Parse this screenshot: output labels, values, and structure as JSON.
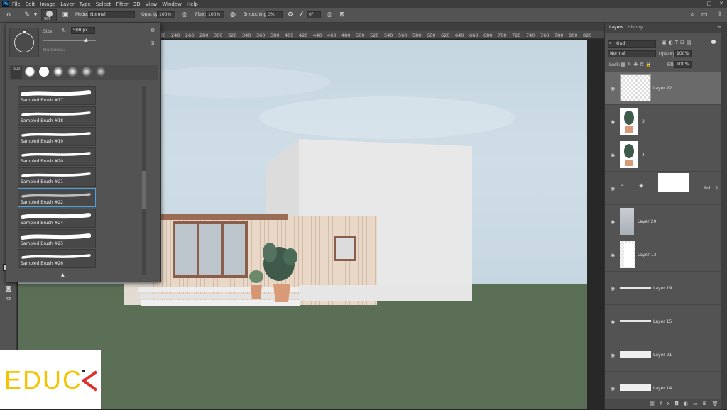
{
  "menubar": {
    "app_icon": "Ps",
    "items": [
      "File",
      "Edit",
      "Image",
      "Layer",
      "Type",
      "Select",
      "Filter",
      "3D",
      "View",
      "Window",
      "Help"
    ]
  },
  "options_bar": {
    "brush_size": "500",
    "mode_label": "Mode:",
    "mode_value": "Normal",
    "opacity_label": "Opacity:",
    "opacity_value": "100%",
    "flow_label": "Flow:",
    "flow_value": "100%",
    "smoothing_label": "Smoothing:",
    "smoothing_value": "0%",
    "angle_value": "0°"
  },
  "brush_panel": {
    "size_label": "Size:",
    "size_value": "500 px",
    "hardness_label": "Hardness:",
    "preset_size": "500",
    "brushes": [
      {
        "name": "Sampled Brush #17",
        "selected": false
      },
      {
        "name": "Sampled Brush #18",
        "selected": false
      },
      {
        "name": "Sampled Brush #19",
        "selected": false
      },
      {
        "name": "Sampled Brush #20",
        "selected": false
      },
      {
        "name": "Sampled Brush #21",
        "selected": false
      },
      {
        "name": "Sampled Brush #22",
        "selected": true
      },
      {
        "name": "Sampled Brush #24",
        "selected": false
      },
      {
        "name": "Sampled Brush #25",
        "selected": false
      },
      {
        "name": "Sampled Brush #26",
        "selected": false
      }
    ]
  },
  "ruler": {
    "ticks": [
      "200",
      "220",
      "240",
      "260",
      "280",
      "300",
      "320",
      "340",
      "360",
      "380",
      "400",
      "420",
      "440",
      "460",
      "480",
      "500",
      "520",
      "540",
      "560",
      "580",
      "600",
      "620",
      "640",
      "660",
      "680",
      "700",
      "720",
      "740",
      "760",
      "780",
      "800",
      "820"
    ]
  },
  "layers_panel": {
    "tabs": [
      "Layers",
      "History"
    ],
    "filter_kind": "Kind",
    "blend_mode": "Normal",
    "opacity_label": "Opacity:",
    "opacity_value": "100%",
    "lock_label": "Lock:",
    "fill_label": "Fill:",
    "fill_value": "100%",
    "layers": [
      {
        "name": "Layer 22",
        "thumb": "transparent",
        "active": true
      },
      {
        "name": "3",
        "thumb": "plant",
        "active": false
      },
      {
        "name": "4",
        "thumb": "plant",
        "active": false
      },
      {
        "name": "Bri... 1",
        "thumb": "adjustment",
        "active": false
      },
      {
        "name": "Layer 20",
        "thumb": "texture",
        "active": false
      },
      {
        "name": "Layer 13",
        "thumb": "white-shape",
        "active": false
      },
      {
        "name": "Layer 19",
        "thumb": "stroke",
        "active": false
      },
      {
        "name": "Layer 15",
        "thumb": "stroke",
        "active": false
      },
      {
        "name": "Layer 21",
        "thumb": "stroke-thick",
        "active": false
      },
      {
        "name": "Layer 14",
        "thumb": "stroke-thick",
        "active": false
      }
    ],
    "adj_number": "4"
  },
  "logo": {
    "text": "EDUC",
    "accent_color": "#e0302a",
    "text_color": "#f5c400"
  },
  "colors": {
    "sky": "#c8d8e2",
    "ground": "#5a6e55",
    "building": "#e6e6e6",
    "wood": "#e8d6c6",
    "frame": "#8b5e4c",
    "selection": "#4aa3df"
  }
}
